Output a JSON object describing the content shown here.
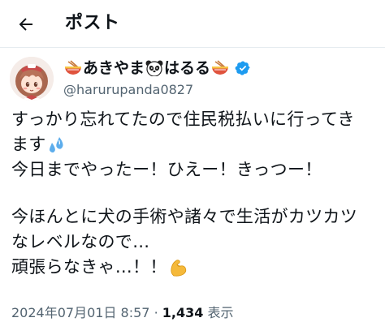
{
  "header": {
    "title": "ポスト",
    "back_icon": "arrow-left-icon"
  },
  "author": {
    "name_part1": "あきやま",
    "name_part2": "はるる",
    "handle": "@harurupanda0827",
    "verified_color": "#1d9bf0",
    "icons": [
      "ramen-icon",
      "panda-icon",
      "ramen-icon",
      "verified-badge-icon"
    ]
  },
  "tweet": {
    "line1": "すっかり忘れてたので住民税払いに行ってき",
    "line2": "ます",
    "line3": "今日までやったー！ひえー！きっつー！",
    "line4": "今ほんとに犬の手術や諸々で生活がカツカツ",
    "line5": "なレベルなので…",
    "line6": "頑張らなきゃ…！！",
    "emoji_sweat": "sweat-droplets-icon",
    "emoji_muscle": "flexed-biceps-icon"
  },
  "meta": {
    "datetime": "2024年07月01日 8:57",
    "separator": "·",
    "views_count": "1,434",
    "views_label": "表示"
  }
}
